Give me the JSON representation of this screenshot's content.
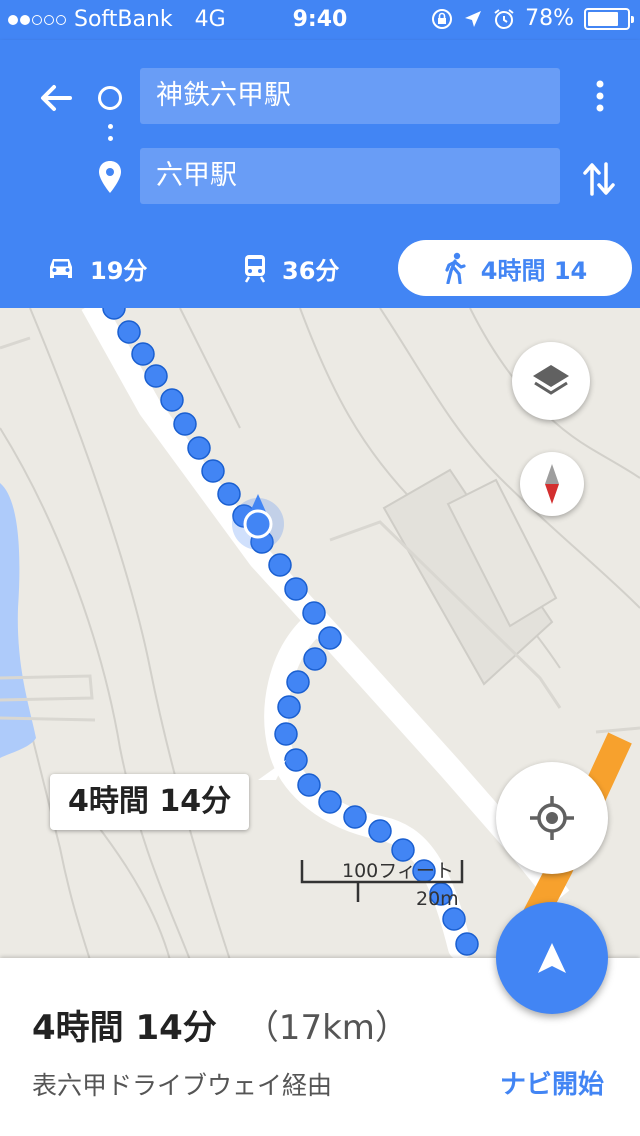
{
  "status_bar": {
    "carrier": "SoftBank",
    "network": "4G",
    "time": "9:40",
    "battery": "78%",
    "battery_level": 0.78
  },
  "directions": {
    "origin": "神鉄六甲駅",
    "destination": "六甲駅"
  },
  "modes": {
    "car": "19分",
    "transit": "36分",
    "walk": "4時間 14"
  },
  "map": {
    "callout": "4時間 14分",
    "scale_feet": "100フィート",
    "scale_meters": "20m"
  },
  "summary": {
    "duration": "4時間 14分",
    "distance": "（17km）",
    "via": "表六甲ドライブウェイ経由",
    "navigate_label": "ナビ開始"
  },
  "colors": {
    "accent": "#4285f4",
    "route": "#4285f4",
    "highway": "#f7a12d"
  }
}
